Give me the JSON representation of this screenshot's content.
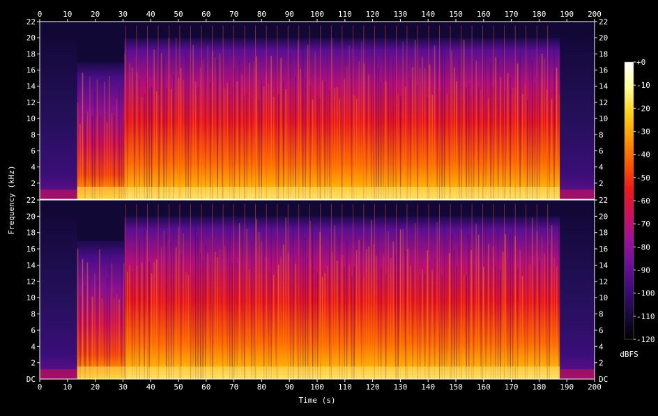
{
  "chart_data": {
    "type": "heatmap",
    "title": "",
    "xlabel": "Time (s)",
    "ylabel": "Frequency (kHz)",
    "xlim": [
      0,
      200
    ],
    "x_ticks": [
      0,
      10,
      20,
      30,
      40,
      50,
      60,
      70,
      80,
      90,
      100,
      110,
      120,
      130,
      140,
      150,
      160,
      170,
      180,
      190,
      200
    ],
    "ylim_khz": [
      0,
      22
    ],
    "y_ticks": [
      2,
      4,
      6,
      8,
      10,
      12,
      14,
      16,
      18,
      20,
      22
    ],
    "y_zero_label": "DC",
    "channels": 2,
    "colorbar": {
      "label": "dBFS",
      "range": [
        -120,
        0
      ],
      "ticks": [
        0,
        -10,
        -20,
        -30,
        -40,
        -50,
        -60,
        -70,
        -80,
        -90,
        -100,
        -110,
        -120
      ],
      "tick_labels": [
        "+0",
        "-10",
        "-20",
        "-30",
        "-40",
        "-50",
        "-60",
        "-70",
        "-80",
        "-90",
        "-100",
        "-110",
        "-120"
      ],
      "colors": [
        "#000000",
        "#1a0a40",
        "#3f0a7a",
        "#6e0f9c",
        "#a0109a",
        "#d0105a",
        "#f01818",
        "#ff5a00",
        "#ff9a00",
        "#ffd21a",
        "#ffff9a",
        "#ffffff"
      ]
    },
    "segments": [
      {
        "start": 0,
        "end": 13.5,
        "level_db": -95,
        "cutoff_khz": 20,
        "note": "quiet intro"
      },
      {
        "start": 13.5,
        "end": 30.5,
        "level_db": -55,
        "cutoff_khz": 17
      },
      {
        "start": 30.5,
        "end": 187.5,
        "level_db": -45,
        "cutoff_khz": 20
      },
      {
        "start": 187.5,
        "end": 200,
        "level_db": -95,
        "cutoff_khz": 20,
        "note": "quiet outro"
      }
    ]
  }
}
